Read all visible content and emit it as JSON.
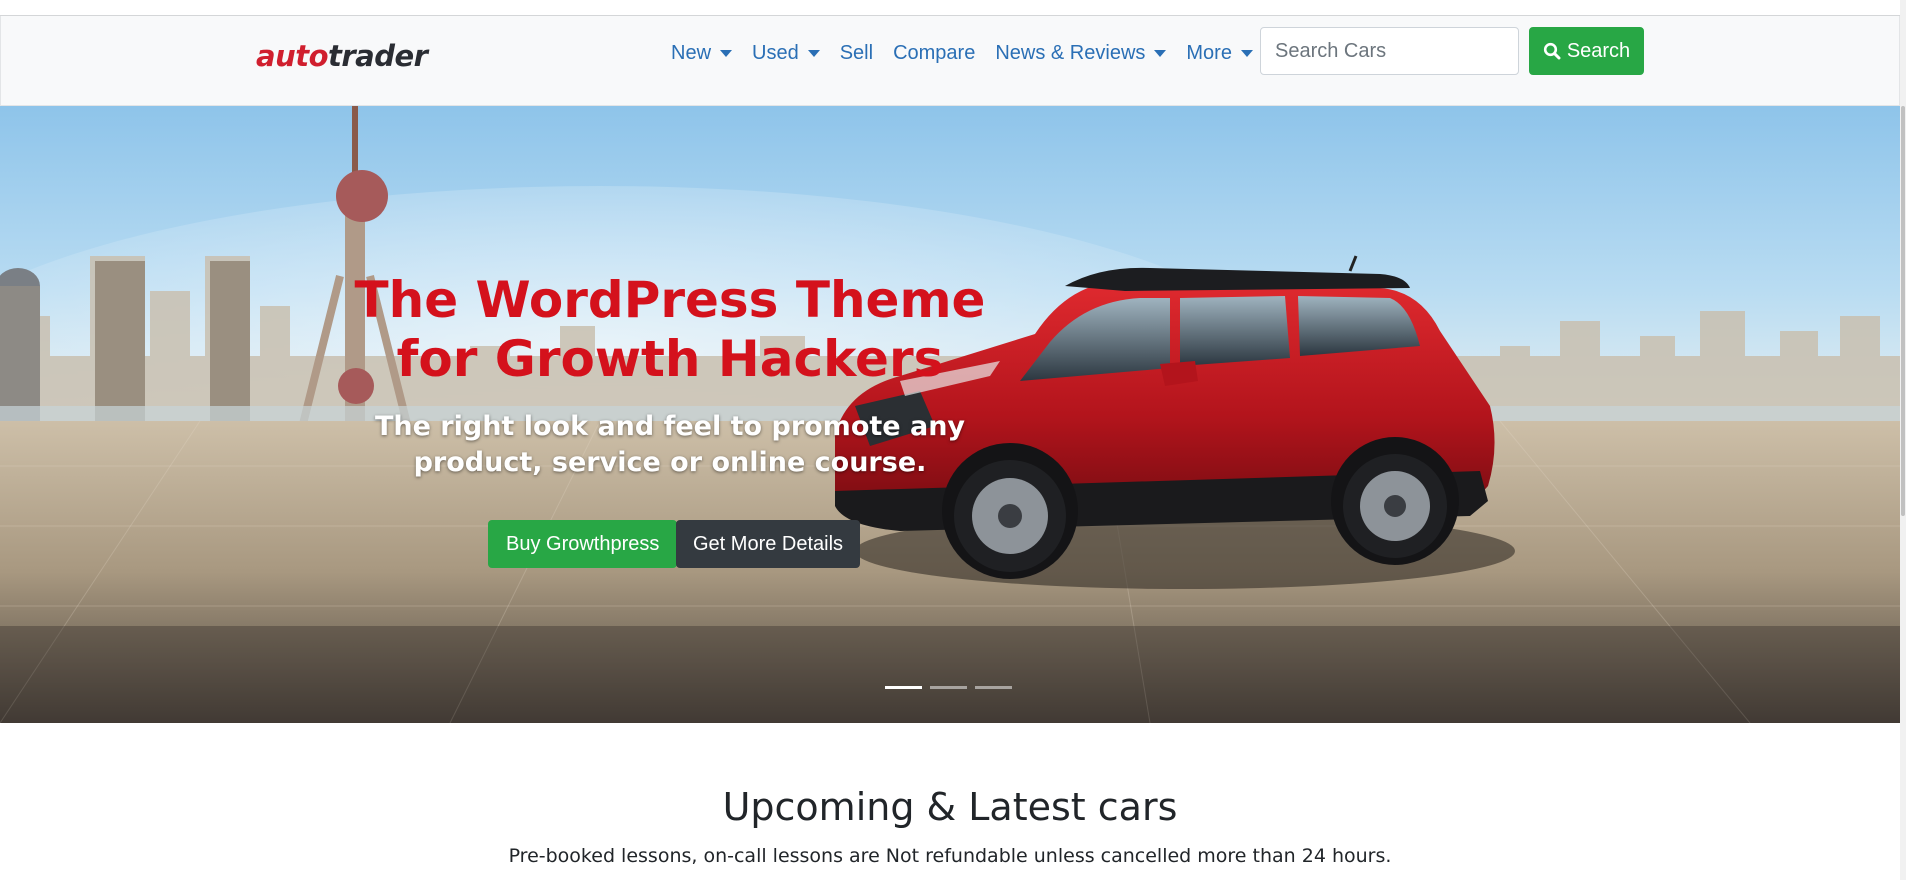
{
  "brand": {
    "part1": "auto",
    "part2": "trader"
  },
  "nav": {
    "items": [
      {
        "label": "New",
        "dropdown": true
      },
      {
        "label": "Used",
        "dropdown": true
      },
      {
        "label": "Sell",
        "dropdown": false
      },
      {
        "label": "Compare",
        "dropdown": false
      },
      {
        "label": "News & Reviews",
        "dropdown": true
      },
      {
        "label": "More",
        "dropdown": true
      }
    ]
  },
  "search": {
    "placeholder": "Search Cars",
    "value": "",
    "button_label": "Search"
  },
  "hero": {
    "title": "The WordPress Theme for Growth Hackers",
    "subtitle": "The right look and feel to promote any product, service or online course.",
    "primary_button": "Buy Growthpress",
    "secondary_button": "Get More Details",
    "slides_count": 3,
    "active_slide": 1
  },
  "section": {
    "title": "Upcoming & Latest cars",
    "subtitle": "Pre-booked lessons, on-call lessons are Not refundable unless cancelled more than 24 hours."
  },
  "colors": {
    "brand_red": "#d01f2e",
    "link_blue": "#2a6fb5",
    "success_green": "#28a745",
    "dark": "#343a40",
    "hero_title_red": "#d4111c"
  }
}
